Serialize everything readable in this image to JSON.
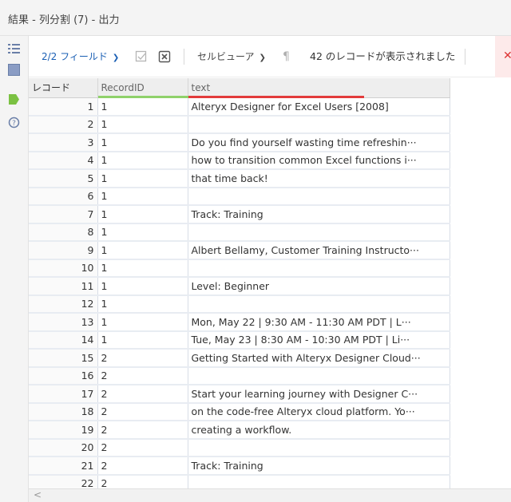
{
  "window": {
    "title": "結果 - 列分割 (7) - 出力"
  },
  "toolbar": {
    "fields_label": "2/2 フィールド",
    "viewer_label": "セルビューア",
    "record_count_text": "42 のレコードが表示されました"
  },
  "table": {
    "headers": [
      "レコード",
      "RecordID",
      "text"
    ],
    "header_underline_colors": {
      "RecordID": "#8fd16a",
      "text": "#e23b3b"
    },
    "rows": [
      {
        "n": "1",
        "id": "1",
        "text": "Alteryx Designer for Excel Users [2008]"
      },
      {
        "n": "2",
        "id": "1",
        "text": ""
      },
      {
        "n": "3",
        "id": "1",
        "text": "Do you find yourself wasting time refreshin···"
      },
      {
        "n": "4",
        "id": "1",
        "text": "how to transition common Excel functions i···"
      },
      {
        "n": "5",
        "id": "1",
        "text": "that time back!"
      },
      {
        "n": "6",
        "id": "1",
        "text": ""
      },
      {
        "n": "7",
        "id": "1",
        "text": "Track: Training"
      },
      {
        "n": "8",
        "id": "1",
        "text": ""
      },
      {
        "n": "9",
        "id": "1",
        "text": "Albert Bellamy, Customer Training Instructo···"
      },
      {
        "n": "10",
        "id": "1",
        "text": ""
      },
      {
        "n": "11",
        "id": "1",
        "text": "Level: Beginner"
      },
      {
        "n": "12",
        "id": "1",
        "text": ""
      },
      {
        "n": "13",
        "id": "1",
        "text": "Mon, May 22 | 9:30 AM - 11:30 AM PDT | L···"
      },
      {
        "n": "14",
        "id": "1",
        "text": "Tue, May 23 | 8:30 AM - 10:30 AM PDT | Li···"
      },
      {
        "n": "15",
        "id": "2",
        "text": "Getting Started with Alteryx Designer Cloud···"
      },
      {
        "n": "16",
        "id": "2",
        "text": ""
      },
      {
        "n": "17",
        "id": "2",
        "text": "Start your learning journey with Designer C···"
      },
      {
        "n": "18",
        "id": "2",
        "text": "on the code-free Alteryx cloud platform. Yo···"
      },
      {
        "n": "19",
        "id": "2",
        "text": "creating a workflow."
      },
      {
        "n": "20",
        "id": "2",
        "text": ""
      },
      {
        "n": "21",
        "id": "2",
        "text": "Track: Training"
      },
      {
        "n": "22",
        "id": "2",
        "text": ""
      }
    ]
  },
  "icons": {
    "sidebar": [
      "list-icon",
      "table-icon",
      "tag-icon",
      "help-icon"
    ],
    "toolbar": [
      "checkbox-icon",
      "clear-icon",
      "pilcrow-icon",
      "close-icon"
    ]
  },
  "colors": {
    "link": "#1a5fb4",
    "tag_green": "#7bc142",
    "close_red": "#d33333"
  }
}
